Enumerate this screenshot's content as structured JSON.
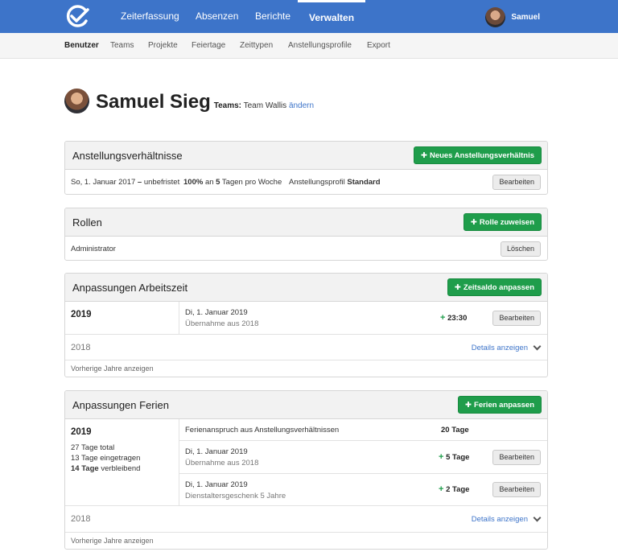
{
  "nav": {
    "items": [
      "Zeiterfassung",
      "Absenzen",
      "Berichte",
      "Verwalten"
    ],
    "user": "Samuel"
  },
  "subnav": [
    "Benutzer",
    "Teams",
    "Projekte",
    "Feiertage",
    "Zeittypen",
    "Anstellungsprofile",
    "Export"
  ],
  "profile": {
    "name": "Samuel Sieg",
    "teams_label": "Teams:",
    "team": "Team Wallis",
    "change": "ändern"
  },
  "employment": {
    "title": "Anstellungsverhältnisse",
    "add_button": "Neues Anstellungsverhältnis",
    "row": {
      "period_date": "So, 1. Januar 2017",
      "period_dash": " – ",
      "period_end": "unbefristet",
      "percent": "100%",
      "at": " an ",
      "days": "5",
      "days_suffix": " Tagen pro Woche",
      "profile_label": "Anstellungsprofil ",
      "profile_value": "Standard",
      "edit": "Bearbeiten"
    }
  },
  "roles": {
    "title": "Rollen",
    "add_button": "Rolle zuweisen",
    "row": {
      "role": "Administrator",
      "delete": "Löschen"
    }
  },
  "worktime": {
    "title": "Anpassungen Arbeitszeit",
    "add_button": "Zeitsaldo anpassen",
    "current_year": "2019",
    "entries": [
      {
        "date": "Di, 1. Januar 2019",
        "desc": "Übernahme aus 2018",
        "value": "23:30",
        "edit": "Bearbeiten"
      }
    ],
    "prev_year": "2018",
    "details": "Details anzeigen",
    "show_prev": "Vorherige Jahre anzeigen"
  },
  "vacation": {
    "title": "Anpassungen Ferien",
    "add_button": "Ferien anpassen",
    "current_year": "2019",
    "summary": {
      "total": "27 Tage total",
      "entered": "13 Tage eingetragen",
      "remaining_bold": "14 Tage",
      "remaining_rest": " verbleibend"
    },
    "entitlement": {
      "label": "Ferienanspruch aus Anstellungsverhältnissen",
      "value": "20 Tage"
    },
    "entries": [
      {
        "date": "Di, 1. Januar 2019",
        "desc": "Übernahme aus 2018",
        "value": "5 Tage",
        "edit": "Bearbeiten"
      },
      {
        "date": "Di, 1. Januar 2019",
        "desc": "Dienstaltersgeschenk 5 Jahre",
        "value": "2 Tage",
        "edit": "Bearbeiten"
      }
    ],
    "prev_year": "2018",
    "details": "Details anzeigen",
    "show_prev": "Vorherige Jahre anzeigen"
  },
  "colors": {
    "primary": "#3d74c9",
    "success": "#1f9d4b"
  },
  "icons": {
    "logo": "check-circle-icon",
    "add": "plus-icon",
    "expand": "chevron-down-icon"
  }
}
